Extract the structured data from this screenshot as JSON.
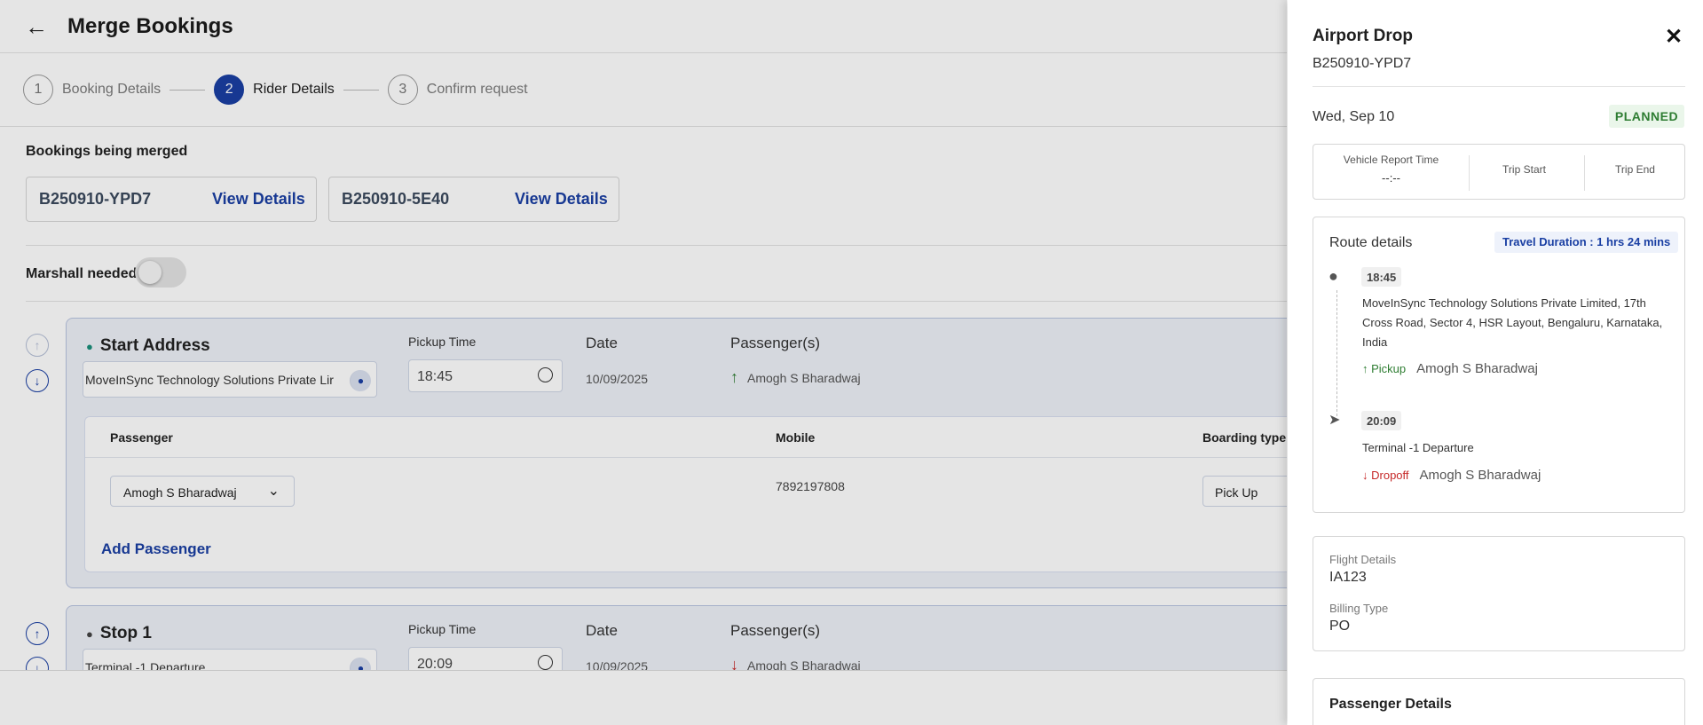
{
  "header": {
    "title": "Merge Bookings"
  },
  "stepper": [
    {
      "num": "1",
      "label": "Booking Details"
    },
    {
      "num": "2",
      "label": "Rider Details"
    },
    {
      "num": "3",
      "label": "Confirm request"
    }
  ],
  "merged": {
    "title": "Bookings being merged",
    "cards": [
      {
        "id": "B250910-YPD7",
        "link": "View Details"
      },
      {
        "id": "B250910-5E40",
        "link": "View Details"
      }
    ]
  },
  "marshall": {
    "label": "Marshall needed",
    "on": false
  },
  "stops": [
    {
      "title": "Start Address",
      "address": "MoveInSync Technology Solutions Private Lir",
      "pickup_label": "Pickup Time",
      "pickup_time": "18:45",
      "date_label": "Date",
      "date": "10/09/2025",
      "pax_label": "Passenger(s)",
      "passenger": "Amogh S Bharadwaj",
      "table": {
        "headers": {
          "passenger": "Passenger",
          "mobile": "Mobile",
          "boarding": "Boarding type"
        },
        "row": {
          "passenger": "Amogh S Bharadwaj",
          "mobile": "7892197808",
          "boarding": "Pick Up"
        },
        "add_label": "Add Passenger"
      }
    },
    {
      "title": "Stop 1",
      "address": "Terminal -1 Departure",
      "pickup_label": "Pickup Time",
      "pickup_time": "20:09",
      "date_label": "Date",
      "date": "10/09/2025",
      "pax_label": "Passenger(s)",
      "passenger": "Amogh S Bharadwaj"
    }
  ],
  "drawer": {
    "title": "Airport Drop",
    "booking_id": "B250910-YPD7",
    "date": "Wed, Sep 10",
    "status": "PLANNED",
    "times": [
      {
        "label": "Vehicle Report Time",
        "value": "--:--"
      },
      {
        "label": "Trip Start",
        "value": ""
      },
      {
        "label": "Trip End",
        "value": ""
      }
    ],
    "route": {
      "title": "Route details",
      "duration": "Travel Duration : 1 hrs 24 mins",
      "stops": [
        {
          "time": "18:45",
          "address": "MoveInSync Technology Solutions Private Limited, 17th Cross Road, Sector 4, HSR Layout, Bengaluru, Karnataka, India",
          "action": "Pickup",
          "name": "Amogh S Bharadwaj"
        },
        {
          "time": "20:09",
          "address": "Terminal -1 Departure",
          "action": "Dropoff",
          "name": "Amogh S Bharadwaj"
        }
      ]
    },
    "flight": {
      "label": "Flight Details",
      "value": "IA123",
      "billing_label": "Billing Type",
      "billing_value": "PO"
    },
    "passenger_details_title": "Passenger Details"
  },
  "colors": {
    "brand": "#1a3fa3",
    "status_green": "#2e7d32",
    "dropoff_red": "#c62828"
  }
}
